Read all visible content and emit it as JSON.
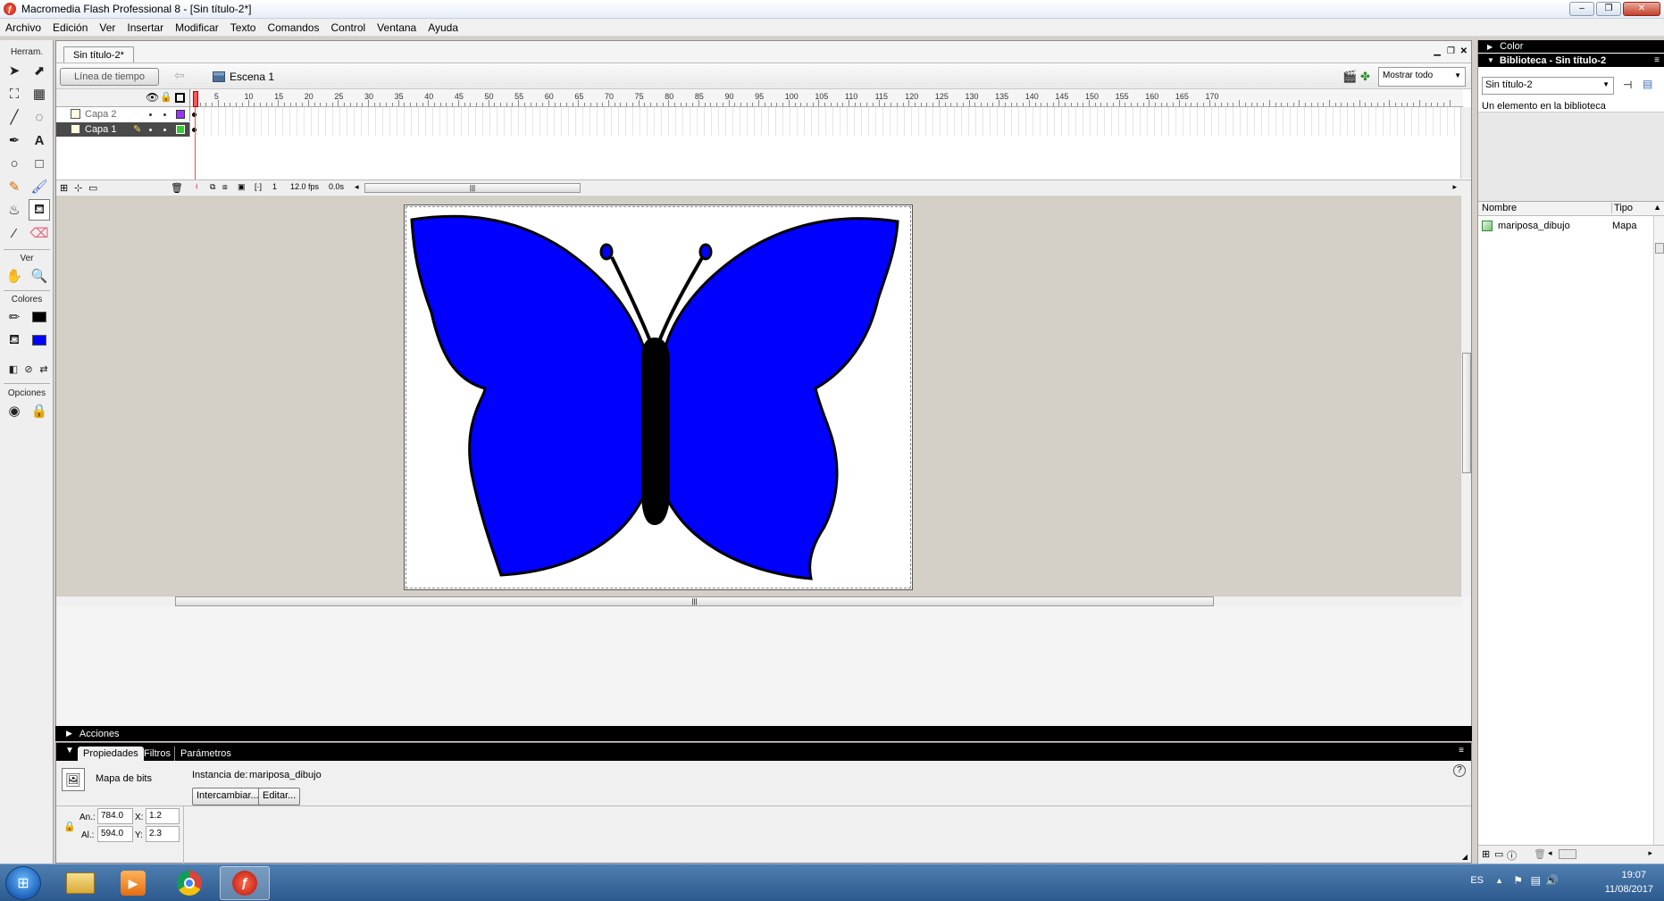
{
  "window": {
    "title": "Macromedia Flash Professional 8 - [Sin título-2*]",
    "minimize": "–",
    "maximize": "❐",
    "close": "✕"
  },
  "menu": [
    "Archivo",
    "Edición",
    "Ver",
    "Insertar",
    "Modificar",
    "Texto",
    "Comandos",
    "Control",
    "Ventana",
    "Ayuda"
  ],
  "tools": {
    "header": "Herram.",
    "view_label": "Ver",
    "colors_label": "Colores",
    "options_label": "Opciones",
    "stroke_color": "#000000",
    "fill_color": "#0000ff"
  },
  "document": {
    "tab_label": "Sin título-2*",
    "timeline_button": "Línea de tiempo",
    "scene_label": "Escena 1",
    "zoom": "Mostrar todo",
    "layers": [
      {
        "name": "Capa 2",
        "color": "#9933ff"
      },
      {
        "name": "Capa 1",
        "color": "#33cc33"
      }
    ],
    "ruler_ticks": [
      "5",
      "10",
      "15",
      "20",
      "25",
      "30",
      "35",
      "40",
      "45",
      "50",
      "55",
      "60",
      "65",
      "70",
      "75",
      "80",
      "85",
      "90",
      "95",
      "100",
      "105",
      "110",
      "115",
      "120",
      "125",
      "130",
      "135",
      "140",
      "145",
      "150",
      "155",
      "160",
      "165",
      "170"
    ],
    "current_frame": "1",
    "frame_rate": "12.0 fps",
    "elapsed": "0.0s",
    "stage_fill": "#0000ff"
  },
  "actions_panel": {
    "label": "Acciones"
  },
  "properties": {
    "tabs": [
      "Propiedades",
      "Filtros",
      "Parámetros"
    ],
    "type_label": "Mapa de bits",
    "instance_label": "Instancia de:",
    "instance_name": "mariposa_dibujo",
    "swap_button": "Intercambiar...",
    "edit_button": "Editar...",
    "width_label": "An.:",
    "width": "784.0",
    "height_label": "Al.:",
    "height": "594.0",
    "x_label": "X:",
    "x": "1.2",
    "y_label": "Y:",
    "y": "2.3",
    "help": "?"
  },
  "right_panels": {
    "color_label": "Color",
    "library_title": "Biblioteca - Sin título-2",
    "library_select": "Sin título-2",
    "library_count": "Un elemento en la biblioteca",
    "col_name": "Nombre",
    "col_type": "Tipo",
    "items": [
      {
        "name": "mariposa_dibujo",
        "type": "Mapa"
      }
    ]
  },
  "taskbar": {
    "lang": "ES",
    "time": "19:07",
    "date": "11/08/2017"
  }
}
